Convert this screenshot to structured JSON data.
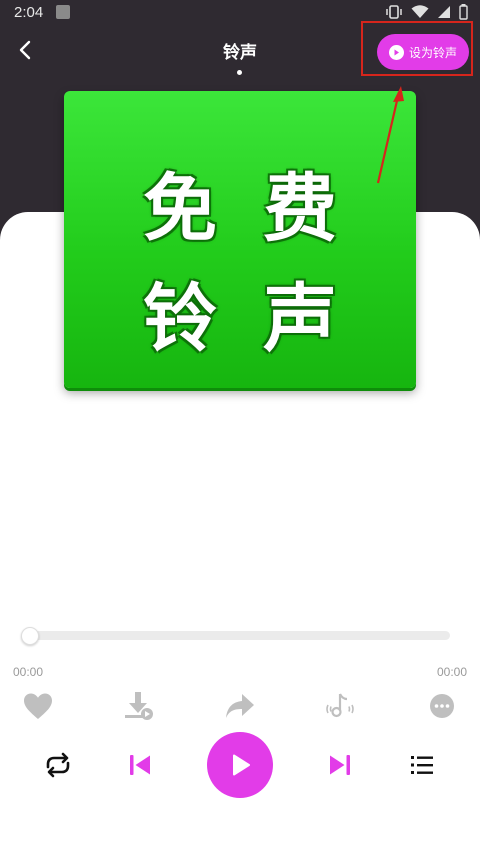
{
  "status_bar": {
    "time": "2:04"
  },
  "header": {
    "title": "铃声",
    "set_ringtone_label": "设为铃声"
  },
  "cover": {
    "line1": "免费",
    "line2": "铃声",
    "background_color": "#22cc1b"
  },
  "player": {
    "current_time": "00:00",
    "total_time": "00:00",
    "progress": 0,
    "accent_color": "#e23ce8"
  },
  "actions": [
    {
      "name": "like",
      "icon": "heart-icon"
    },
    {
      "name": "download",
      "icon": "download-icon"
    },
    {
      "name": "share",
      "icon": "share-icon"
    },
    {
      "name": "tiktok-ringtone",
      "icon": "music-note-wave-icon"
    },
    {
      "name": "more",
      "icon": "more-dots-icon"
    }
  ],
  "controls": [
    {
      "name": "repeat",
      "icon": "repeat-icon"
    },
    {
      "name": "previous",
      "icon": "skip-previous-icon"
    },
    {
      "name": "play",
      "icon": "play-icon"
    },
    {
      "name": "next",
      "icon": "skip-next-icon"
    },
    {
      "name": "playlist",
      "icon": "playlist-icon"
    }
  ]
}
